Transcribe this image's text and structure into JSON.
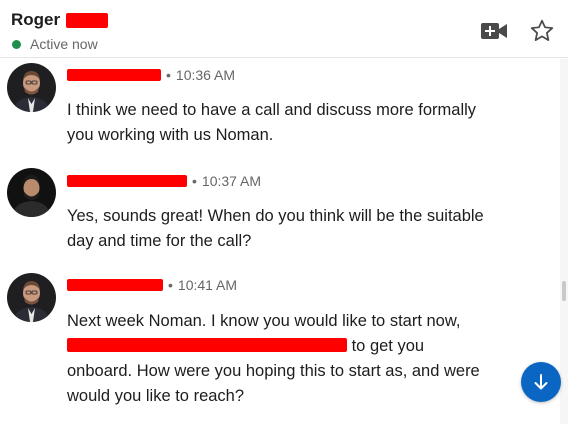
{
  "header": {
    "contact_name": "Roger",
    "status": "Active now",
    "status_color": "#1f8f4e",
    "video_call_icon": "video-plus-icon",
    "star_icon": "star-outline-icon"
  },
  "messages": [
    {
      "time": "10:36 AM",
      "sender_redacted": true,
      "text": "I think we need to have a call and discuss more formally you working with us Noman."
    },
    {
      "time": "10:37 AM",
      "sender_redacted": true,
      "text": "Yes, sounds great! When do you think will be the suitable day and time for the call?"
    },
    {
      "time": "10:41 AM",
      "sender_redacted": true,
      "text_before": "Next week Noman. I know you would like to start now,",
      "text_after": "to get you onboard. How were you hoping this to start as, and were would you like to reach?"
    }
  ],
  "scroll_button": {
    "icon": "arrow-down-icon",
    "color": "#0a66c2"
  },
  "colors": {
    "redaction": "#ff0000",
    "accent": "#0a66c2"
  }
}
